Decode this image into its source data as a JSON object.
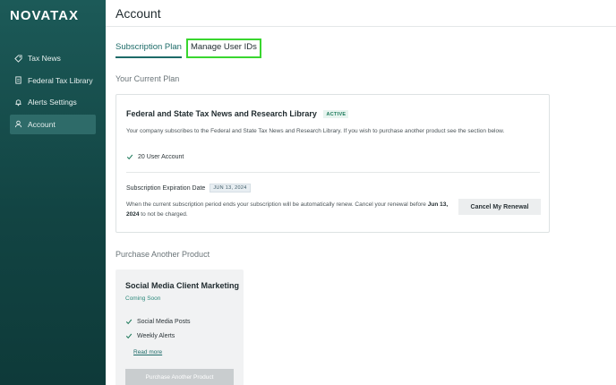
{
  "app": {
    "logo": "NOVATAX"
  },
  "sidebar": {
    "items": [
      {
        "label": "Tax News",
        "icon": "tag-icon"
      },
      {
        "label": "Federal Tax Library",
        "icon": "document-icon"
      },
      {
        "label": "Alerts Settings",
        "icon": "bell-icon"
      },
      {
        "label": "Account",
        "icon": "user-icon",
        "active": true
      }
    ]
  },
  "header": {
    "title": "Account"
  },
  "tabs": [
    {
      "label": "Subscription Plan",
      "active": true
    },
    {
      "label": "Manage User IDs",
      "highlighted": true
    }
  ],
  "current_plan": {
    "heading": "Your Current Plan",
    "title": "Federal and State Tax News and Research Library",
    "status_badge": "ACTIVE",
    "description": "Your company subscribes to the Federal and State Tax News and Research Library. If you wish to purchase another product see the section below.",
    "feature": "20 User Account",
    "expiration_label": "Subscription Expiration Date",
    "expiration_date": "JUN 13, 2024",
    "renewal_text_before": "When the current subscription period ends your subscription will be automatically renew. Cancel your renewal before ",
    "renewal_date": "Jun 13, 2024",
    "renewal_text_after": " to not be charged.",
    "cancel_button": "Cancel My Renewal"
  },
  "purchase": {
    "heading": "Purchase Another Product",
    "product": {
      "title": "Social Media Client Marketing",
      "status": "Coming Soon",
      "features": [
        "Social Media Posts",
        "Weekly Alerts"
      ],
      "read_more": "Read more",
      "button": "Purchase Another Product"
    }
  },
  "colors": {
    "sidebar_bg": "#124443",
    "accent": "#1d6b68",
    "highlight": "#39d62f"
  }
}
